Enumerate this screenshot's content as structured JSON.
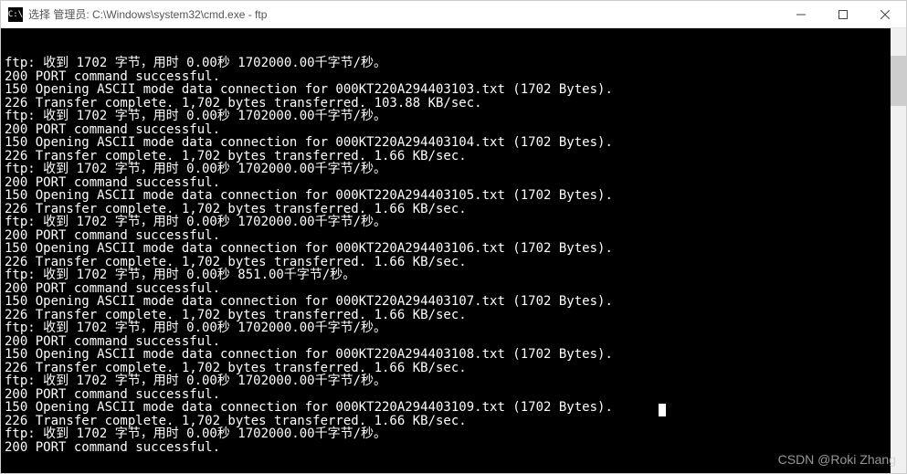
{
  "titlebar": {
    "icon_label": "C:\\",
    "title": "选择 管理员: C:\\Windows\\system32\\cmd.exe - ftp"
  },
  "watermark": "CSDN @Roki Zhang",
  "terminal_lines": [
    "ftp: 收到 1702 字节，用时 0.00秒 1702000.00千字节/秒。",
    "200 PORT command successful.",
    "150 Opening ASCII mode data connection for 000KT220A294403103.txt (1702 Bytes).",
    "226 Transfer complete. 1,702 bytes transferred. 103.88 KB/sec.",
    "ftp: 收到 1702 字节，用时 0.00秒 1702000.00千字节/秒。",
    "200 PORT command successful.",
    "150 Opening ASCII mode data connection for 000KT220A294403104.txt (1702 Bytes).",
    "226 Transfer complete. 1,702 bytes transferred. 1.66 KB/sec.",
    "ftp: 收到 1702 字节，用时 0.00秒 1702000.00千字节/秒。",
    "200 PORT command successful.",
    "150 Opening ASCII mode data connection for 000KT220A294403105.txt (1702 Bytes).",
    "226 Transfer complete. 1,702 bytes transferred. 1.66 KB/sec.",
    "ftp: 收到 1702 字节，用时 0.00秒 1702000.00千字节/秒。",
    "200 PORT command successful.",
    "150 Opening ASCII mode data connection for 000KT220A294403106.txt (1702 Bytes).",
    "226 Transfer complete. 1,702 bytes transferred. 1.66 KB/sec.",
    "ftp: 收到 1702 字节，用时 0.00秒 851.00千字节/秒。",
    "200 PORT command successful.",
    "150 Opening ASCII mode data connection for 000KT220A294403107.txt (1702 Bytes).",
    "226 Transfer complete. 1,702 bytes transferred. 1.66 KB/sec.",
    "ftp: 收到 1702 字节，用时 0.00秒 1702000.00千字节/秒。",
    "200 PORT command successful.",
    "150 Opening ASCII mode data connection for 000KT220A294403108.txt (1702 Bytes).",
    "226 Transfer complete. 1,702 bytes transferred. 1.66 KB/sec.",
    "ftp: 收到 1702 字节，用时 0.00秒 1702000.00千字节/秒。",
    "200 PORT command successful.",
    "150 Opening ASCII mode data connection for 000KT220A294403109.txt (1702 Bytes).",
    "226 Transfer complete. 1,702 bytes transferred. 1.66 KB/sec.",
    "ftp: 收到 1702 字节，用时 0.00秒 1702000.00千字节/秒。",
    "200 PORT command successful."
  ]
}
